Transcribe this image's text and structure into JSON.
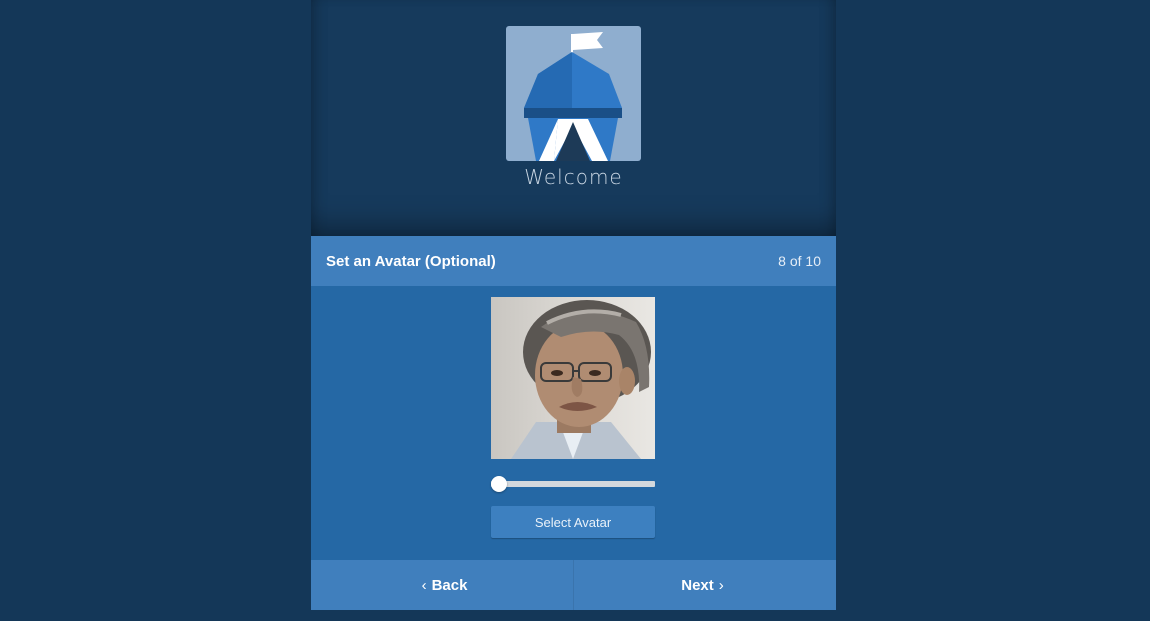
{
  "hero": {
    "welcome_text": "Welcome",
    "logo_icon": "openbazaar-tent-icon"
  },
  "step": {
    "title": "Set an Avatar (Optional)",
    "progress": "8 of 10"
  },
  "avatar": {
    "image_icon": "avatar-photo",
    "zoom_slider_value": 0
  },
  "buttons": {
    "select_avatar": "Select Avatar",
    "back": "Back",
    "next": "Next",
    "back_icon": "chevron-left-icon",
    "next_icon": "chevron-right-icon"
  },
  "colors": {
    "background": "#143758",
    "hero": "#163a5c",
    "header": "#407fbd",
    "content": "#2568a5",
    "logo_bg": "#8faecf"
  }
}
